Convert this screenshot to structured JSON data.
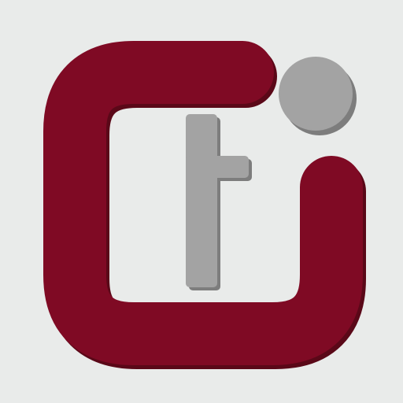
{
  "logo": {
    "name": "ct-logo",
    "colors": {
      "background": "#e9ebea",
      "primary": "#7f0a24",
      "primary_shadow": "#5a0818",
      "secondary": "#a3a3a3",
      "secondary_shadow": "#7d7d7d"
    },
    "parts": [
      "c-ring-shape",
      "t-letter-shape",
      "dot-shape"
    ]
  }
}
